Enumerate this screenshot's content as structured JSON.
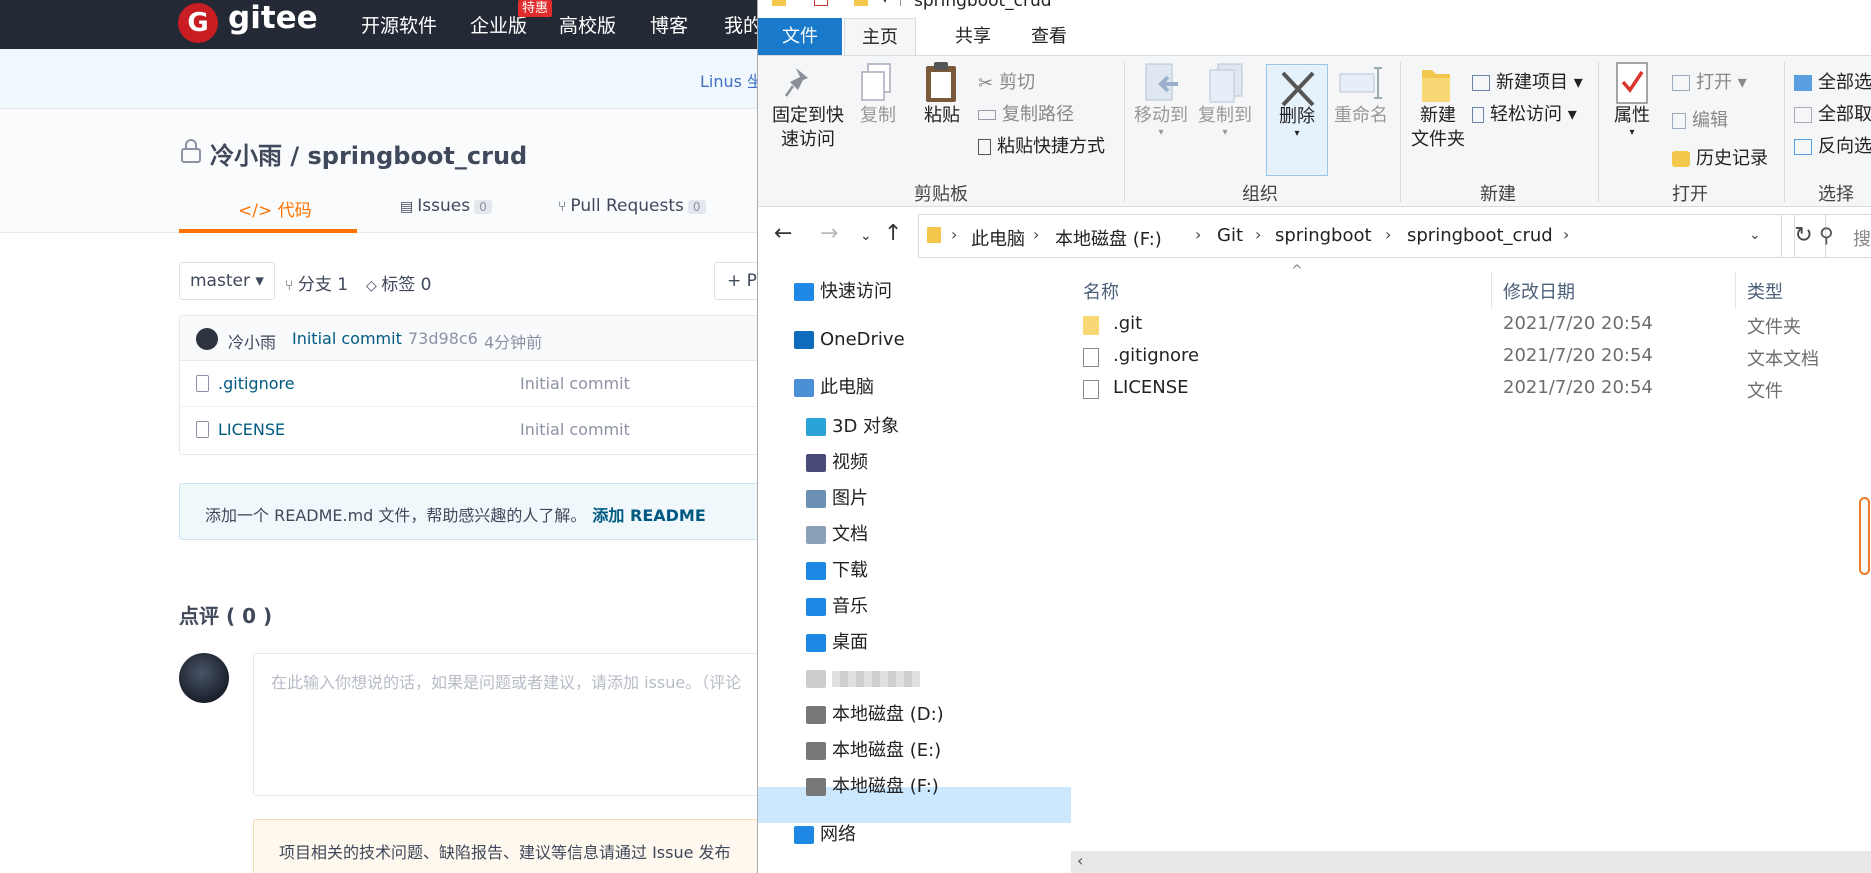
{
  "gitee": {
    "logo_letter": "G",
    "logo_text": "gitee",
    "nav": [
      "开源软件",
      "企业版",
      "高校版",
      "博客",
      "我的"
    ],
    "nav_badge": "特惠",
    "banner": "Linus 坐",
    "repo_owner_slash_name": "冷小雨 / springboot_crud",
    "tabs": [
      {
        "label": "</> 代码",
        "count": ""
      },
      {
        "label": "Issues",
        "count": "0"
      },
      {
        "label": "Pull Requests",
        "count": "0"
      }
    ],
    "branch": "master ▾",
    "branches": "分支 1",
    "tags": "标签 0",
    "pr_button": "+ Pu",
    "commit": {
      "author": "冷小雨",
      "message": "Initial commit",
      "hash": "73d98c6",
      "time": "4分钟前"
    },
    "files": [
      {
        "name": ".gitignore",
        "message": "Initial commit"
      },
      {
        "name": "LICENSE",
        "message": "Initial commit"
      }
    ],
    "readme_prompt": "添加一个 README.md 文件，帮助感兴趣的人了解。",
    "readme_link": "添加 README",
    "comments_title": "点评 ( 0 )",
    "comment_placeholder": "在此输入你想说的话，如果是问题或者建议，请添加 issue。（评论",
    "notice": "项目相关的技术问题、缺陷报告、建议等信息请通过 Issue 发布"
  },
  "explorer": {
    "title": "springboot_crud",
    "tabs": [
      "文件",
      "主页",
      "共享",
      "查看"
    ],
    "ribbon": {
      "clipboard": {
        "label": "剪贴板",
        "pin": "固定到快\n速访问",
        "pin_l1": "固定到快",
        "pin_l2": "速访问",
        "copy": "复制",
        "paste": "粘贴",
        "cut": "剪切",
        "copy_path": "复制路径",
        "paste_shortcut": "粘贴快捷方式"
      },
      "organize": {
        "label": "组织",
        "move_to": "移动到",
        "copy_to": "复制到",
        "delete": "删除",
        "rename": "重命名"
      },
      "new": {
        "label": "新建",
        "new_folder_l1": "新建",
        "new_folder_l2": "文件夹",
        "new_item": "新建项目 ▾",
        "easy_access": "轻松访问 ▾"
      },
      "open": {
        "label": "打开",
        "properties": "属性",
        "open": "打开 ▾",
        "edit": "编辑",
        "history": "历史记录"
      },
      "select": {
        "label": "选择",
        "select_all": "全部选",
        "select_none": "全部取",
        "invert": "反向选"
      }
    },
    "breadcrumb": [
      "此电脑",
      "本地磁盘 (F:)",
      "Git",
      "springboot",
      "springboot_crud"
    ],
    "search_placeholder": "搜",
    "nav_items": [
      {
        "label": "快速访问",
        "icon": "star-icon",
        "color": "#1e88e5"
      },
      {
        "label": "OneDrive",
        "icon": "cloud-icon",
        "color": "#0f6cbd"
      },
      {
        "label": "此电脑",
        "icon": "computer-icon",
        "color": "#4a90d9"
      },
      {
        "label": "3D 对象",
        "icon": "cube-icon",
        "color": "#29a3d8"
      },
      {
        "label": "视频",
        "icon": "film-icon",
        "color": "#4b4b7a"
      },
      {
        "label": "图片",
        "icon": "picture-icon",
        "color": "#6b8fb3"
      },
      {
        "label": "文档",
        "icon": "document-icon",
        "color": "#8aa0b8"
      },
      {
        "label": "下载",
        "icon": "download-icon",
        "color": "#1e88e5"
      },
      {
        "label": "音乐",
        "icon": "music-icon",
        "color": "#1e88e5"
      },
      {
        "label": "桌面",
        "icon": "desktop-icon",
        "color": "#1e88e5"
      },
      {
        "label": "",
        "icon": "drive-icon",
        "color": "#cccccc"
      },
      {
        "label": "本地磁盘 (D:)",
        "icon": "drive-icon",
        "color": "#777777"
      },
      {
        "label": "本地磁盘 (E:)",
        "icon": "drive-icon",
        "color": "#777777"
      },
      {
        "label": "本地磁盘 (F:)",
        "icon": "drive-icon",
        "color": "#777777"
      },
      {
        "label": "网络",
        "icon": "network-icon",
        "color": "#1e88e5"
      }
    ],
    "columns": [
      "名称",
      "修改日期",
      "类型"
    ],
    "files": [
      {
        "name": ".git",
        "date": "2021/7/20 20:54",
        "type": "文件夹",
        "icon": "folder-icon"
      },
      {
        "name": ".gitignore",
        "date": "2021/7/20 20:54",
        "type": "文本文档",
        "icon": "text-file-icon"
      },
      {
        "name": "LICENSE",
        "date": "2021/7/20 20:54",
        "type": "文件",
        "icon": "file-icon"
      }
    ]
  }
}
